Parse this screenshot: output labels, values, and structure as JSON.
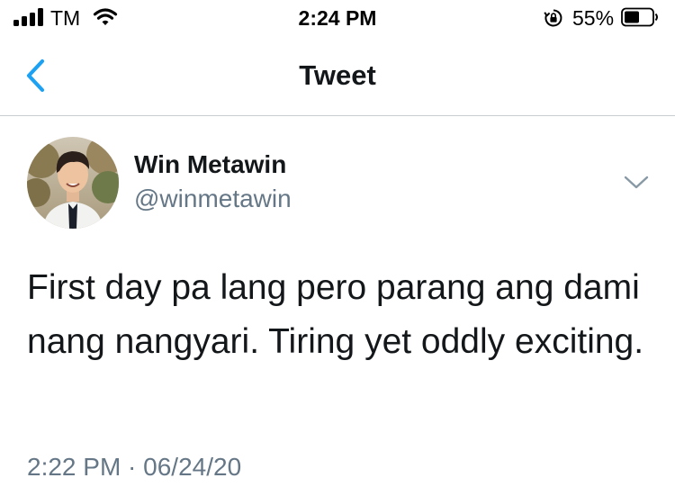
{
  "status_bar": {
    "carrier": "TM",
    "time": "2:24 PM",
    "battery_percent": "55%",
    "icons": [
      "signal-icon",
      "wifi-icon",
      "orientation-lock-icon",
      "battery-icon"
    ]
  },
  "nav": {
    "title": "Tweet",
    "back_icon": "chevron-left-icon"
  },
  "tweet": {
    "display_name": "Win Metawin",
    "handle": "@winmetawin",
    "text": "First day pa lang pero parang ang dami nang nangyari. Tiring yet oddly exciting.",
    "timestamp": "2:22 PM · 06/24/20",
    "menu_icon": "chevron-down-icon"
  },
  "colors": {
    "accent": "#1da1f2",
    "primary_text": "#14171a",
    "secondary_text": "#657786",
    "divider": "#c8cdd1"
  }
}
